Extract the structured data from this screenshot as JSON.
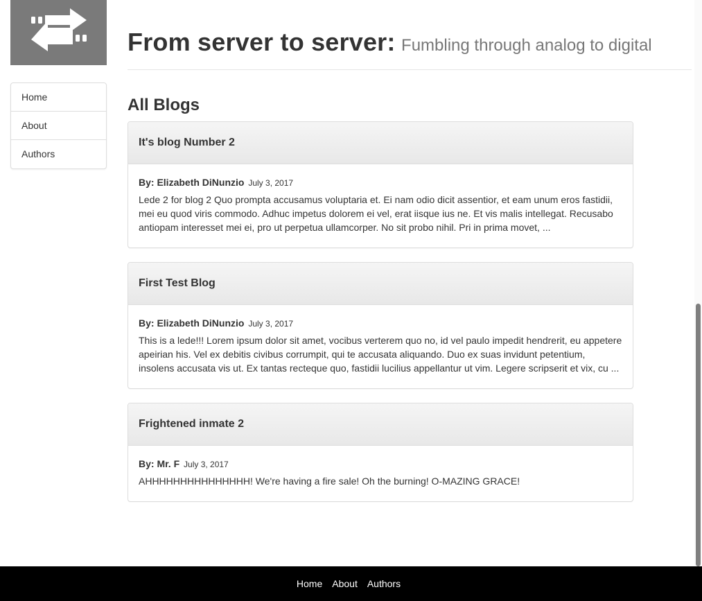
{
  "header": {
    "title": "From server to server:",
    "subtitle": "Fumbling through analog to digital"
  },
  "logo": {
    "icon": "swap-arrows-icon",
    "color": "#7a7a7a"
  },
  "sidebar": {
    "items": [
      {
        "label": "Home"
      },
      {
        "label": "About"
      },
      {
        "label": "Authors"
      }
    ]
  },
  "main": {
    "section_title": "All Blogs",
    "posts": [
      {
        "title": "It's blog Number 2",
        "by_label": "By:",
        "author": "Elizabeth DiNunzio",
        "date": "July 3, 2017",
        "lede": "Lede 2 for blog 2 Quo prompta accusamus voluptaria et. Ei nam odio dicit assentior, et eam unum eros fastidii, mei eu quod viris commodo. Adhuc impetus dolorem ei vel, erat iisque ius ne. Et vis malis intellegat. Recusabo antiopam interesset mei ei, pro ut perpetua ullamcorper. No sit probo nihil. Pri in prima movet, ..."
      },
      {
        "title": "First Test Blog",
        "by_label": "By:",
        "author": "Elizabeth DiNunzio",
        "date": "July 3, 2017",
        "lede": "This is a lede!!! Lorem ipsum dolor sit amet, vocibus verterem quo no, id vel paulo impedit hendrerit, eu appetere apeirian his. Vel ex debitis civibus corrumpit, qui te accusata aliquando. Duo ex suas invidunt petentium, insolens accusata vis ut. Ex tantas recteque quo, fastidii lucilius appellantur ut vim. Legere scripserit et vix, cu ..."
      },
      {
        "title": "Frightened inmate 2",
        "by_label": "By:",
        "author": "Mr. F",
        "date": "July 3, 2017",
        "lede": "AHHHHHHHHHHHHHHH! We're having a fire sale! Oh the burning! O-MAZING GRACE!"
      }
    ]
  },
  "footer": {
    "links": [
      {
        "label": "Home"
      },
      {
        "label": "About"
      },
      {
        "label": "Authors"
      }
    ]
  }
}
